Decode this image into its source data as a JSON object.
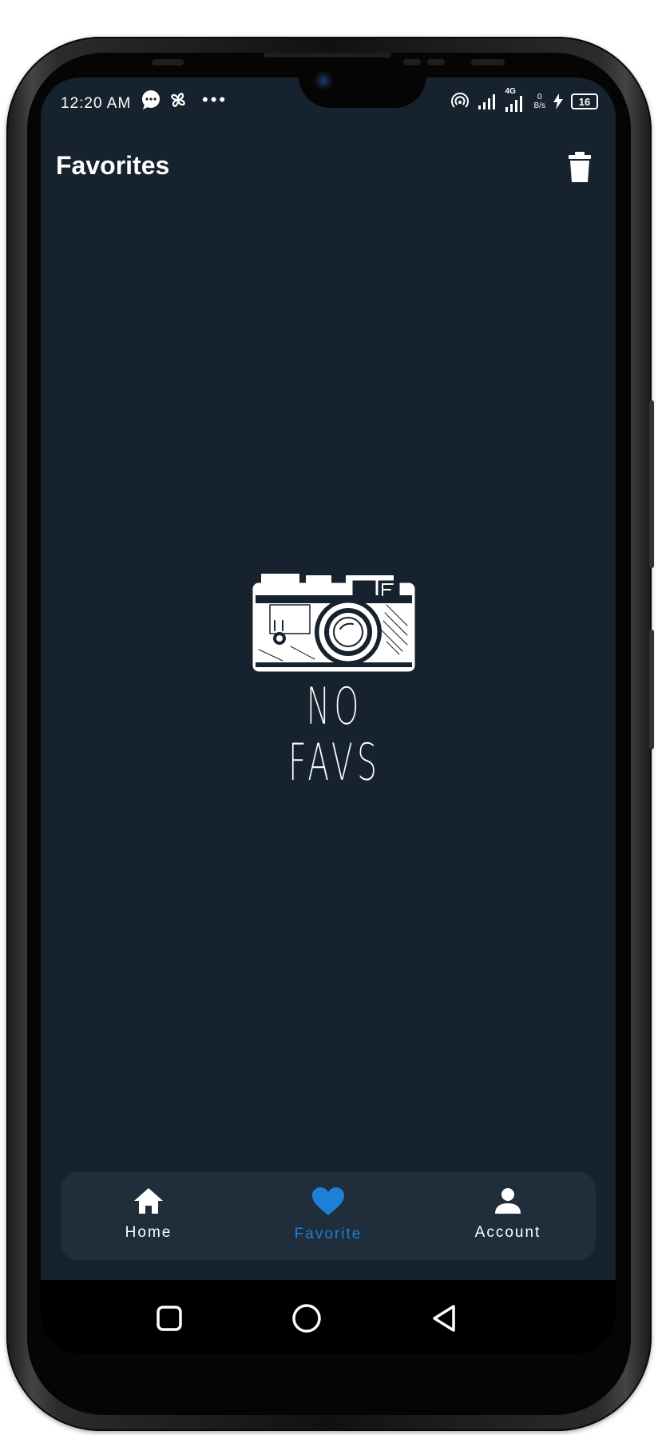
{
  "status_bar": {
    "time": "12:20 AM",
    "network": "4G",
    "net_speed_value": "0",
    "net_speed_unit": "B/s",
    "battery": "16",
    "icons": [
      "chat-bubble-icon",
      "pinwheel-icon",
      "more-dots-icon",
      "hotspot-icon",
      "signal-icon",
      "signal-4g-icon",
      "charging-icon",
      "battery-icon"
    ]
  },
  "header": {
    "title": "Favorites",
    "action_icon": "trash-icon"
  },
  "empty_state": {
    "icon": "camera-sketch-icon",
    "text": "NO FAVS"
  },
  "bottom_nav": {
    "items": [
      {
        "label": "Home",
        "icon": "home-icon",
        "active": false
      },
      {
        "label": "Favorite",
        "icon": "heart-icon",
        "active": true
      },
      {
        "label": "Account",
        "icon": "person-icon",
        "active": false
      }
    ]
  },
  "system_nav": [
    "recents-square-icon",
    "home-circle-icon",
    "back-triangle-icon"
  ],
  "colors": {
    "background": "#16222d",
    "nav_background": "#202d3a",
    "accent": "#1e7fd6",
    "text": "#ffffff"
  }
}
